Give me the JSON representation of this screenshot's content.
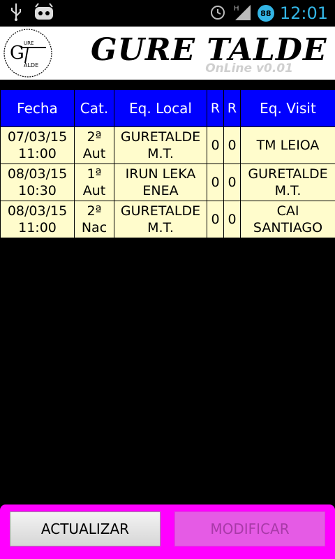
{
  "status_bar": {
    "time": "12:01",
    "battery_level": "88",
    "icons": [
      "usb-icon",
      "android-icon",
      "alarm-icon",
      "signal-icon",
      "battery-icon"
    ]
  },
  "header": {
    "title": "GURE TALDE",
    "version": "OnLine v0.01",
    "logo_text": "GT TALDE"
  },
  "table": {
    "columns": [
      "Fecha",
      "Cat.",
      "Eq. Local",
      "R",
      "R",
      "Eq. Visit"
    ],
    "rows": [
      {
        "date": "07/03/15",
        "time": "11:00",
        "cat1": "2ª",
        "cat2": "Aut",
        "local1": "GURETALDE",
        "local2": "M.T.",
        "r1": "0",
        "r2": "0",
        "visit1": "TM LEIOA",
        "visit2": ""
      },
      {
        "date": "08/03/15",
        "time": "10:30",
        "cat1": "1ª",
        "cat2": "Aut",
        "local1": "IRUN LEKA",
        "local2": "ENEA",
        "r1": "0",
        "r2": "0",
        "visit1": "GURETALDE",
        "visit2": "M.T."
      },
      {
        "date": "08/03/15",
        "time": "11:00",
        "cat1": "2ª",
        "cat2": "Nac",
        "local1": "GURETALDE",
        "local2": "M.T.",
        "r1": "0",
        "r2": "0",
        "visit1": "CAI",
        "visit2": "SANTIAGO"
      }
    ]
  },
  "buttons": {
    "update_label": "ACTUALIZAR",
    "modify_label": "MODIFICAR"
  },
  "colors": {
    "header_row": "#0000ff",
    "cell_bg": "#fffccc",
    "bottom_bar": "#ff00ff",
    "clock": "#33b5e5"
  }
}
